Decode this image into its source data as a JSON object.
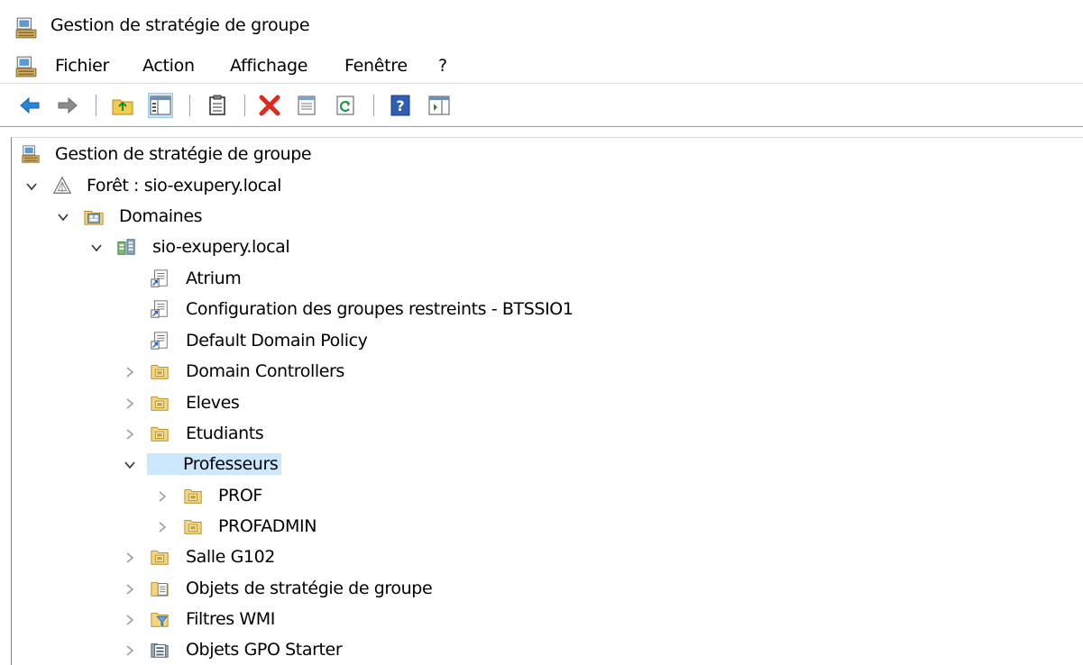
{
  "window": {
    "title": "Gestion de stratégie de groupe"
  },
  "menu": {
    "items": [
      "Fichier",
      "Action",
      "Affichage",
      "Fenêtre",
      "?"
    ]
  },
  "toolbar": {
    "buttons": [
      "back-icon",
      "forward-icon",
      "up-folder-icon",
      "show-hide-tree-icon",
      "copy-icon",
      "delete-icon",
      "properties-icon",
      "refresh-icon",
      "help-icon",
      "show-action-pane-icon"
    ]
  },
  "tree": {
    "root": "Gestion de stratégie de groupe",
    "forest": "Forêt : sio-exupery.local",
    "domains": "Domaines",
    "domain": "sio-exupery.local",
    "gpo_links": [
      "Atrium",
      "Configuration des groupes restreints - BTSSIO1",
      "Default Domain Policy"
    ],
    "ous": [
      "Domain Controllers",
      "Eleves",
      "Etudiants"
    ],
    "selected": "Professeurs",
    "children": [
      "PROF",
      "PROFADMIN"
    ],
    "salle": "Salle G102",
    "containers": [
      "Objets de stratégie de groupe",
      "Filtres WMI",
      "Objets GPO Starter"
    ]
  },
  "colors": {
    "selection": "#cce8ff",
    "toolbar_active": "#cce4f7"
  }
}
